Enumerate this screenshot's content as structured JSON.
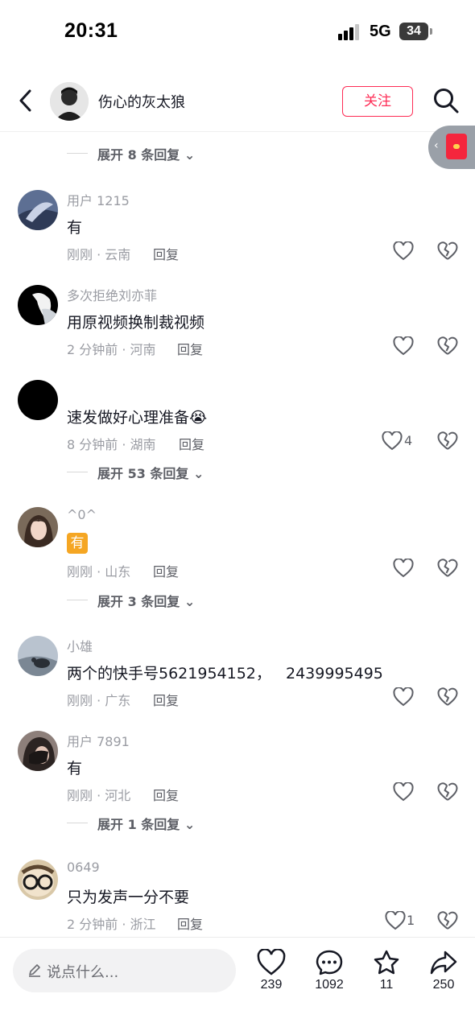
{
  "status_bar": {
    "time": "20:31",
    "network": "5G",
    "battery": "34"
  },
  "header": {
    "username": "伤心的灰太狼",
    "follow_label": "关注"
  },
  "comments": [
    {
      "username": "用户 1215",
      "text": "有",
      "time": "刚刚",
      "location": "云南",
      "reply": "回复",
      "likes": ""
    },
    {
      "username": "多次拒绝刘亦菲",
      "text": "用原视频换制裁视频",
      "time": "2 分钟前",
      "location": "河南",
      "reply": "回复",
      "likes": ""
    },
    {
      "username": "",
      "text": "速发做好心理准备😭",
      "time": "8 分钟前",
      "location": "湖南",
      "reply": "回复",
      "likes": "4"
    },
    {
      "username": "^0^",
      "text": "有",
      "time": "刚刚",
      "location": "山东",
      "reply": "回复",
      "likes": ""
    },
    {
      "username": "小雄",
      "text": "两个的快手号5621954152，   2439995495",
      "time": "刚刚",
      "location": "广东",
      "reply": "回复",
      "likes": ""
    },
    {
      "username": "用户 7891",
      "text": "有",
      "time": "刚刚",
      "location": "河北",
      "reply": "回复",
      "likes": ""
    },
    {
      "username": "0649",
      "text": "只为发声一分不要",
      "time": "2 分钟前",
      "location": "浙江",
      "reply": "回复",
      "likes": "1"
    }
  ],
  "expand_links": [
    "展开 8 条回复",
    "展开 53 条回复",
    "展开 3 条回复",
    "展开 1 条回复"
  ],
  "bottom_bar": {
    "placeholder": "说点什么...",
    "likes": "239",
    "comments": "1092",
    "favorites": "11",
    "shares": "250"
  },
  "colors": {
    "accent": "#fe2c55",
    "secondary_text": "#9a9ca3",
    "reply_text": "#5d5f66",
    "emoji_badge": "#f5a623"
  },
  "icons": [
    "back-icon",
    "search-icon",
    "red-envelope-icon",
    "heart-icon",
    "broken-heart-icon",
    "edit-icon",
    "comment-icon",
    "star-icon",
    "share-icon",
    "chevron-down-icon"
  ]
}
